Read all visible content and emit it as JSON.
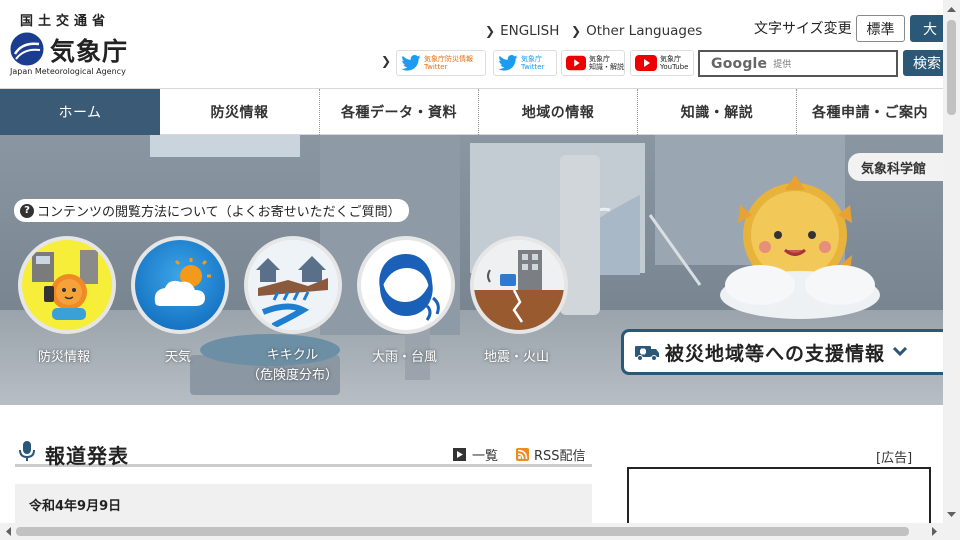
{
  "header": {
    "ministry": "国土交通省",
    "agency_name": "気象庁",
    "agency_en": "Japan Meteorological Agency",
    "links": {
      "english": "ENGLISH",
      "other_languages": "Other Languages"
    },
    "font_size": {
      "label": "文字サイズ変更",
      "standard": "標準",
      "large": "大"
    },
    "sns": [
      {
        "icon": "twitter-icon",
        "line1": "気象庁防災情報",
        "line2": "Twitter"
      },
      {
        "icon": "twitter-icon",
        "line1": "気象庁",
        "line2": "Twitter"
      },
      {
        "icon": "youtube-icon",
        "line1": "気象庁",
        "line2": "知識・解説"
      },
      {
        "icon": "youtube-icon",
        "line1": "気象庁",
        "line2": "YouTube"
      }
    ],
    "search": {
      "google": "Google",
      "provided": "提供",
      "button": "検索"
    }
  },
  "nav": [
    {
      "label": "ホーム",
      "active": true
    },
    {
      "label": "防災情報"
    },
    {
      "label": "各種データ・資料"
    },
    {
      "label": "地域の情報"
    },
    {
      "label": "知識・解説"
    },
    {
      "label": "各種申請・ご案内"
    }
  ],
  "hero": {
    "science_museum": "気象科学館",
    "faq": "コンテンツの閲覧方法について（よくお寄せいただくご質問）",
    "circles": [
      {
        "icon": "disaster-info-icon",
        "label": "防災情報"
      },
      {
        "icon": "weather-icon",
        "label": "天気"
      },
      {
        "icon": "kikikuru-icon",
        "label": "キキクル",
        "sub": "（危険度分布）"
      },
      {
        "icon": "typhoon-icon",
        "label": "大雨・台風"
      },
      {
        "icon": "earthquake-volcano-icon",
        "label": "地震・火山"
      }
    ],
    "support_button": "被災地域等への支援情報"
  },
  "press": {
    "title": "報道発表",
    "list_link": "一覧",
    "rss_link": "RSS配信",
    "date": "令和4年9月9日"
  },
  "ad": {
    "label": "[広告]"
  },
  "colors": {
    "accent": "#2c5878",
    "nav_active": "#3b5a75"
  }
}
